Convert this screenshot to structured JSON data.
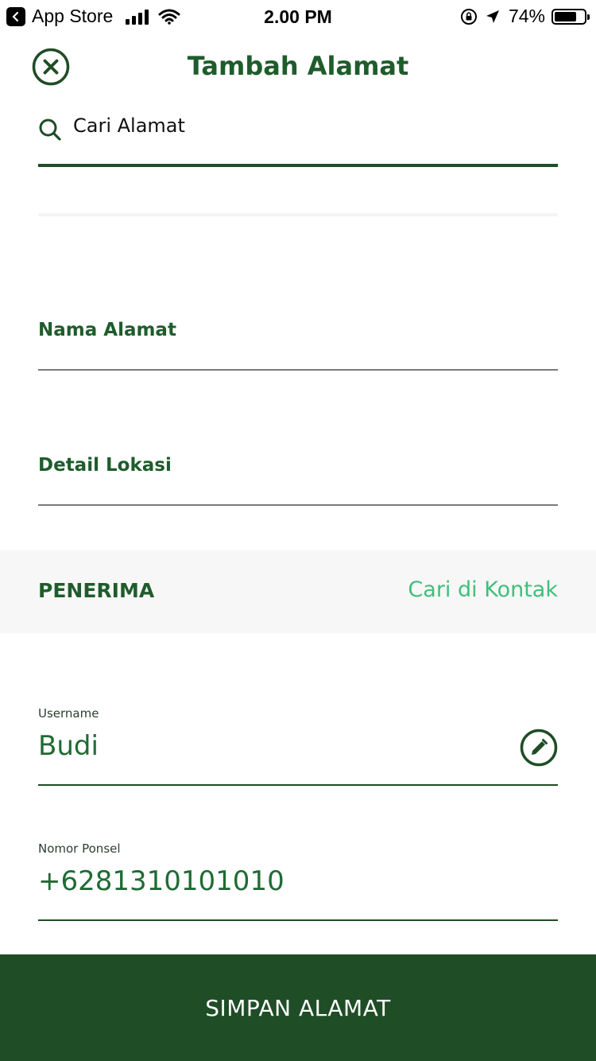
{
  "status_bar": {
    "back_app": "App Store",
    "time": "2.00 PM",
    "battery": "74%",
    "battery_level": 0.74
  },
  "header": {
    "title": "Tambah Alamat",
    "close_icon": "close-circle-icon"
  },
  "search": {
    "placeholder": "Cari Alamat",
    "value": "",
    "icon": "search-icon"
  },
  "fields": {
    "address_name_label": "Nama Alamat",
    "location_detail_label": "Detail Lokasi"
  },
  "recipient_section": {
    "title": "PENERIMA",
    "link": "Cari di Kontak"
  },
  "recipient": {
    "username_label": "Username",
    "username_value": "Budi",
    "phone_label": "Nomor Ponsel",
    "phone_value": "+6281310101010"
  },
  "footer": {
    "save_label": "SIMPAN ALAMAT"
  },
  "colors": {
    "primary": "#1f4d26",
    "accent": "#3fbf7a",
    "section_bg": "#f7f7f7"
  }
}
